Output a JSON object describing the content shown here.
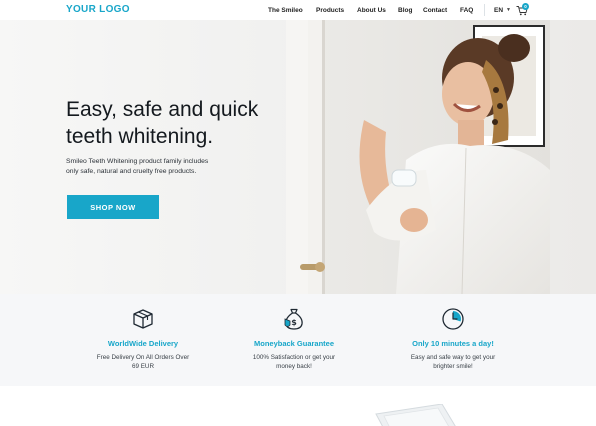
{
  "header": {
    "logo": "YOUR LOGO",
    "nav": [
      "The Smileo",
      "Products",
      "About Us",
      "Blog",
      "Contact",
      "FAQ"
    ],
    "language": "EN",
    "cart_count": "0",
    "icons": [
      "chevron-down-icon",
      "cart-icon"
    ]
  },
  "hero": {
    "title_line1": "Easy, safe and quick",
    "title_line2": "teeth whitening.",
    "subtitle_line1": "Smileo Teeth Whitening product family includes",
    "subtitle_line2": "only safe, natural and cruelty free products.",
    "cta": "SHOP NOW"
  },
  "features": [
    {
      "icon": "box-icon",
      "title": "WorldWide Delivery",
      "desc_line1": "Free Delivery On All Orders Over",
      "desc_line2": "69 EUR"
    },
    {
      "icon": "money-bag-icon",
      "title": "Moneyback Guarantee",
      "desc_line1": "100% Satisfaction or get your",
      "desc_line2": "money back!"
    },
    {
      "icon": "clock-icon",
      "title": "Only 10 minutes a day!",
      "desc_line1": "Easy and safe way to get your",
      "desc_line2": "brighter smile!"
    }
  ],
  "colors": {
    "accent": "#18a6c9",
    "text": "#14191e",
    "feature_bg": "#f6f7f9"
  }
}
